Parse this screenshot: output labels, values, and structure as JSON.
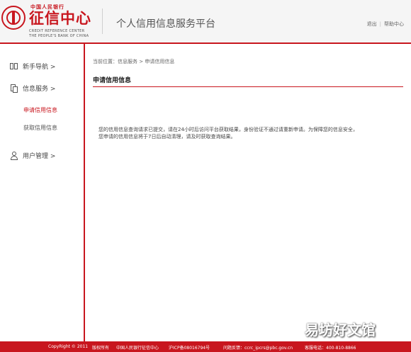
{
  "header": {
    "logo_top": "中国人民银行",
    "logo_main": "征信中心",
    "logo_en_1": "CREDIT REFERENCE CENTER",
    "logo_en_2": "THE PEOPLE'S BANK OF CHINA",
    "platform_title": "个人信用信息服务平台",
    "links": [
      "退出",
      "帮助中心"
    ],
    "link_separator": "|"
  },
  "sidebar": {
    "items": [
      {
        "label": "新手导航 >",
        "icon": "book-icon"
      },
      {
        "label": "信息服务 >",
        "icon": "document-icon"
      },
      {
        "label": "用户管理 >",
        "icon": "user-icon"
      }
    ],
    "sub_items": [
      {
        "label": "申请信用信息",
        "active": true
      },
      {
        "label": "获取信用信息",
        "active": false
      }
    ]
  },
  "main": {
    "breadcrumb": "当前位置：信息服务 > 申请信用信息",
    "section_title": "申请信用信息",
    "message_line1": "您的信用信息查询请求已提交，请在24小时后访问平台获取结果，身份验证不通过请重新申请。为保障您的信息安全，",
    "message_line2": "您申请的信用信息将于7日后自动清理，请及时获取查询结果。"
  },
  "footer": {
    "copyright": "CopyRight © 2011",
    "rights": "版权所有",
    "org": "中国人民银行征信中心",
    "icp": "沪ICP备08016794号",
    "feedback": "问题反馈：ccrc_ipcrs@pbc.gov.cn",
    "hotline": "客服电话：400-810-8866"
  },
  "watermark": "易坊好文馆",
  "colors": {
    "accent": "#c8161e",
    "header_bg": "#f5f5f5"
  }
}
